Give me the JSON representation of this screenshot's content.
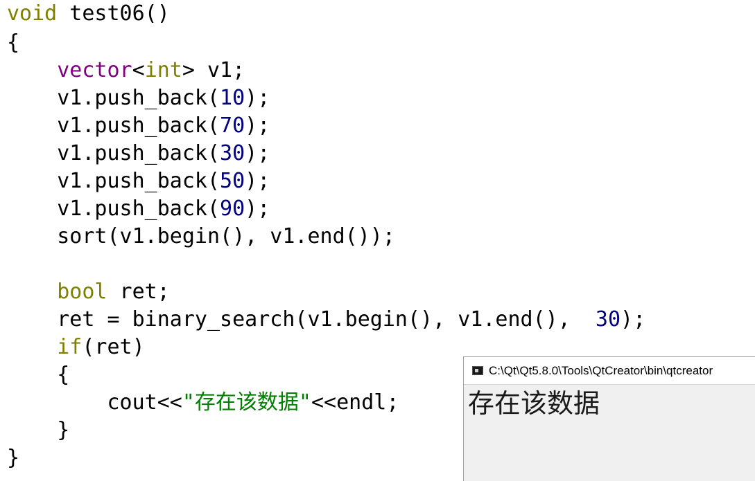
{
  "editor": {
    "lines": [
      [
        {
          "t": "void",
          "c": "kw-type"
        },
        {
          "t": " test06()",
          "c": "plain"
        }
      ],
      [
        {
          "t": "{",
          "c": "plain"
        }
      ],
      [
        {
          "t": "    ",
          "c": "plain"
        },
        {
          "t": "vector",
          "c": "kw-class"
        },
        {
          "t": "<",
          "c": "plain"
        },
        {
          "t": "int",
          "c": "kw-type"
        },
        {
          "t": "> v1;",
          "c": "plain"
        }
      ],
      [
        {
          "t": "    v1.push_back(",
          "c": "plain"
        },
        {
          "t": "10",
          "c": "num"
        },
        {
          "t": ");",
          "c": "plain"
        }
      ],
      [
        {
          "t": "    v1.push_back(",
          "c": "plain"
        },
        {
          "t": "70",
          "c": "num"
        },
        {
          "t": ");",
          "c": "plain"
        }
      ],
      [
        {
          "t": "    v1.push_back(",
          "c": "plain"
        },
        {
          "t": "30",
          "c": "num"
        },
        {
          "t": ");",
          "c": "plain"
        }
      ],
      [
        {
          "t": "    v1.push_back(",
          "c": "plain"
        },
        {
          "t": "50",
          "c": "num"
        },
        {
          "t": ");",
          "c": "plain"
        }
      ],
      [
        {
          "t": "    v1.push_back(",
          "c": "plain"
        },
        {
          "t": "90",
          "c": "num"
        },
        {
          "t": ");",
          "c": "plain"
        }
      ],
      [
        {
          "t": "    sort(v1.begin(), v1.end());",
          "c": "plain"
        }
      ],
      [
        {
          "t": "",
          "c": "plain"
        }
      ],
      [
        {
          "t": "    ",
          "c": "plain"
        },
        {
          "t": "bool",
          "c": "kw-type"
        },
        {
          "t": " ret;",
          "c": "plain"
        }
      ],
      [
        {
          "t": "    ret = binary_search(v1.begin(), v1.end(),  ",
          "c": "plain"
        },
        {
          "t": "30",
          "c": "num"
        },
        {
          "t": ");",
          "c": "plain"
        }
      ],
      [
        {
          "t": "    ",
          "c": "plain"
        },
        {
          "t": "if",
          "c": "kw-ctrl"
        },
        {
          "t": "(ret)",
          "c": "plain"
        }
      ],
      [
        {
          "t": "    {",
          "c": "plain"
        }
      ],
      [
        {
          "t": "        cout<<",
          "c": "plain"
        },
        {
          "t": "\"存在该数据\"",
          "c": "str"
        },
        {
          "t": "<<endl;",
          "c": "plain"
        }
      ],
      [
        {
          "t": "    }",
          "c": "plain"
        }
      ],
      [
        {
          "t": "}",
          "c": "plain"
        }
      ]
    ]
  },
  "console": {
    "title": "C:\\Qt\\Qt5.8.0\\Tools\\QtCreator\\bin\\qtcreator",
    "output": "存在该数据",
    "icon": "console-window-icon"
  }
}
